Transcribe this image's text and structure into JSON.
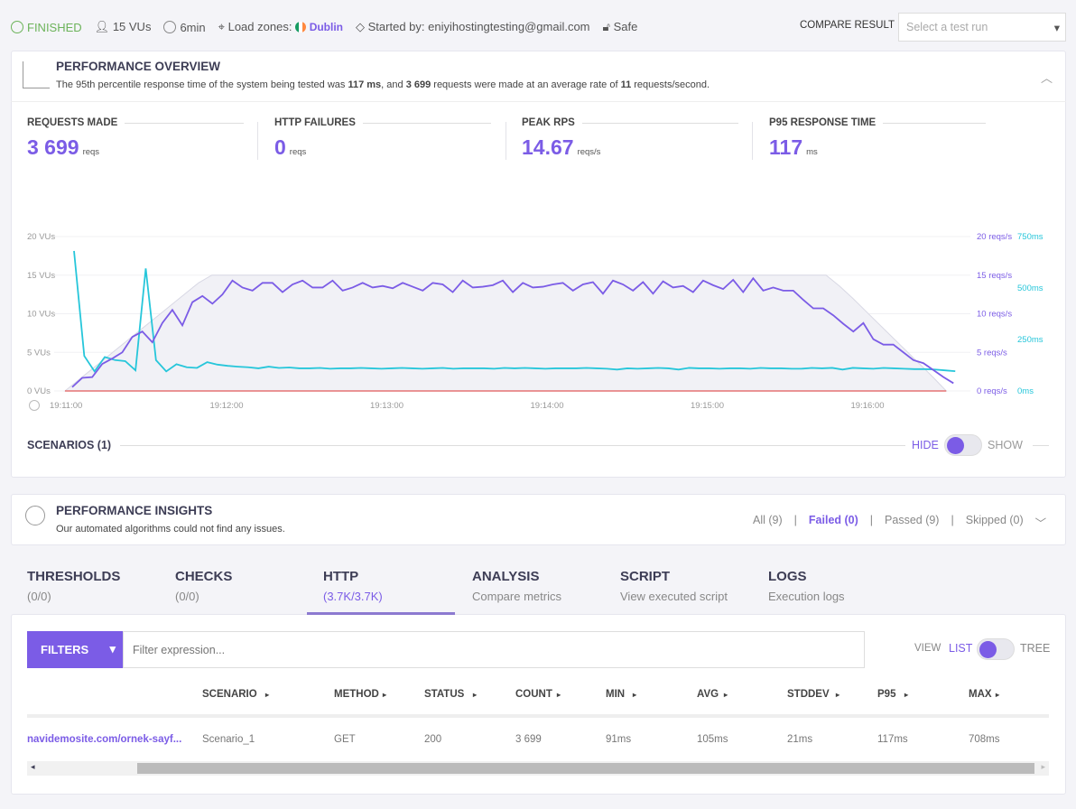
{
  "status": {
    "state": "FINISHED",
    "vus": "15 VUs",
    "duration": "6min",
    "load_zones_label": "Load zones:",
    "load_zone": "Dublin",
    "started_by": "Started by: eniyihostingtesting@gmail.com",
    "safety": "Safe"
  },
  "compare": {
    "label": "COMPARE RESULT",
    "placeholder": "Select a test run"
  },
  "overview": {
    "title": "PERFORMANCE OVERVIEW",
    "summary_pre": "The 95th percentile response time of the system being tested was ",
    "p95": "117 ms",
    "summary_mid": ", and ",
    "requests": "3 699",
    "summary_mid2": " requests were made at an average rate of ",
    "rate": "11",
    "summary_post": " requests/second.",
    "stats": [
      {
        "label": "REQUESTS MADE",
        "value": "3 699",
        "unit": "reqs"
      },
      {
        "label": "HTTP FAILURES",
        "value": "0",
        "unit": "reqs"
      },
      {
        "label": "PEAK RPS",
        "value": "14.67",
        "unit": "reqs/s"
      },
      {
        "label": "P95 RESPONSE TIME",
        "value": "117",
        "unit": "ms"
      }
    ]
  },
  "chart_data": {
    "type": "line",
    "x_ticks": [
      "19:11:00",
      "19:12:00",
      "19:13:00",
      "19:14:00",
      "19:15:00",
      "19:16:00"
    ],
    "y_left_ticks": [
      "0 VUs",
      "5 VUs",
      "10 VUs",
      "15 VUs",
      "20 VUs"
    ],
    "y_right1_ticks": [
      "0 reqs/s",
      "5 reqs/s",
      "10 reqs/s",
      "15 reqs/s",
      "20 reqs/s"
    ],
    "y_right2_ticks": [
      "0ms",
      "250ms",
      "500ms",
      "750ms"
    ],
    "ylim_vus": [
      0,
      20
    ],
    "ylim_rps": [
      0,
      20
    ],
    "ylim_ms": [
      0,
      750
    ],
    "x_step_seconds": 5,
    "x_start": "19:11:00",
    "series": [
      {
        "key": "vus",
        "color": "#d8d8e4",
        "values": [
          0,
          1.4,
          2.8,
          4.2,
          5.6,
          7,
          8.4,
          9.8,
          11.2,
          12.6,
          14,
          15,
          15,
          15,
          15,
          15,
          15,
          15,
          15,
          15,
          15,
          15,
          15,
          15,
          15,
          15,
          15,
          15,
          15,
          15,
          15,
          15,
          15,
          15,
          15,
          15,
          15,
          15,
          15,
          15,
          15,
          15,
          15,
          15,
          15,
          15,
          15,
          15,
          15,
          15,
          15,
          15,
          15,
          15,
          15,
          15,
          15,
          15,
          13.6,
          12,
          10.3,
          8.6,
          6.9,
          5.2,
          3.5,
          1.8,
          0
        ]
      },
      {
        "key": "rps",
        "color": "#7b5ce6",
        "values": [
          0.5,
          1.7,
          1.8,
          3.5,
          4.2,
          5,
          7,
          7.7,
          6.3,
          8.8,
          10.5,
          8.5,
          11.5,
          12.3,
          11.3,
          12.5,
          14.3,
          13.4,
          13,
          14,
          14,
          12.8,
          13.8,
          14.3,
          13.4,
          13.4,
          14.3,
          13,
          13.4,
          14,
          13.4,
          13.6,
          13.3,
          14,
          13.5,
          13,
          14,
          13.8,
          12.8,
          14.3,
          13.4,
          13.5,
          13.7,
          14.3,
          12.8,
          14,
          13.4,
          13.5,
          13.8,
          14,
          13,
          13.8,
          14.1,
          12.6,
          14.3,
          13.8,
          13,
          14.1,
          12.6,
          14.2,
          13.4,
          13.6,
          12.8,
          14.3,
          13.7,
          13.2,
          14.4,
          12.8,
          14.6,
          13,
          13.4,
          13,
          13,
          11.8,
          10.7,
          10.7,
          9.8,
          8.7,
          7.7,
          8.8,
          6.7,
          6,
          6,
          5,
          4,
          3.6,
          2.7,
          1.8,
          1
        ]
      },
      {
        "key": "response_time",
        "color": "#26c6da",
        "values": [
          680,
          170,
          95,
          165,
          150,
          145,
          100,
          595,
          150,
          95,
          130,
          115,
          112,
          140,
          128,
          122,
          118,
          115,
          110,
          118,
          112,
          114,
          110,
          110,
          112,
          108,
          110,
          110,
          112,
          110,
          108,
          110,
          112,
          110,
          108,
          110,
          112,
          108,
          110,
          110,
          110,
          108,
          112,
          110,
          112,
          110,
          108,
          110,
          110,
          110,
          112,
          110,
          108,
          104,
          110,
          108,
          110,
          112,
          110,
          104,
          112,
          110,
          110,
          108,
          110,
          110,
          108,
          112,
          110,
          110,
          108,
          108,
          112,
          110,
          112,
          104,
          112,
          110,
          108,
          112,
          110,
          108,
          106,
          106,
          104,
          100,
          96
        ]
      },
      {
        "key": "http_failures",
        "color": "#e57373",
        "values": [
          0,
          0
        ]
      }
    ]
  },
  "scenarios": {
    "label": "SCENARIOS (1)",
    "hide": "HIDE",
    "show": "SHOW"
  },
  "insights": {
    "title": "PERFORMANCE INSIGHTS",
    "subtitle": "Our automated algorithms could not find any issues.",
    "filters": [
      "All (9)",
      "Failed (0)",
      "Passed (9)",
      "Skipped (0)"
    ],
    "sep": "|"
  },
  "tabs": [
    {
      "title": "THRESHOLDS",
      "sub": "(0/0)"
    },
    {
      "title": "CHECKS",
      "sub": "(0/0)"
    },
    {
      "title": "HTTP",
      "sub": "(3.7K/3.7K)"
    },
    {
      "title": "ANALYSIS",
      "sub": "Compare metrics"
    },
    {
      "title": "SCRIPT",
      "sub": "View executed script"
    },
    {
      "title": "LOGS",
      "sub": "Execution logs"
    }
  ],
  "filter": {
    "button": "FILTERS",
    "placeholder": "Filter expression...",
    "view": "VIEW",
    "list": "LIST",
    "tree": "TREE"
  },
  "table": {
    "headers": [
      "SCENARIO",
      "METHOD",
      "STATUS",
      "COUNT",
      "MIN",
      "AVG",
      "STDDEV",
      "P95",
      "MAX"
    ],
    "rows": [
      {
        "url": "navidemosite.com/ornek-sayf...",
        "cells": [
          "Scenario_1",
          "GET",
          "200",
          "3 699",
          "91ms",
          "105ms",
          "21ms",
          "117ms",
          "708ms"
        ]
      }
    ]
  },
  "colors": {
    "accent": "#7b5ce6",
    "success": "#6cb35a",
    "cyan": "#26c6da",
    "failure": "#e57373"
  }
}
